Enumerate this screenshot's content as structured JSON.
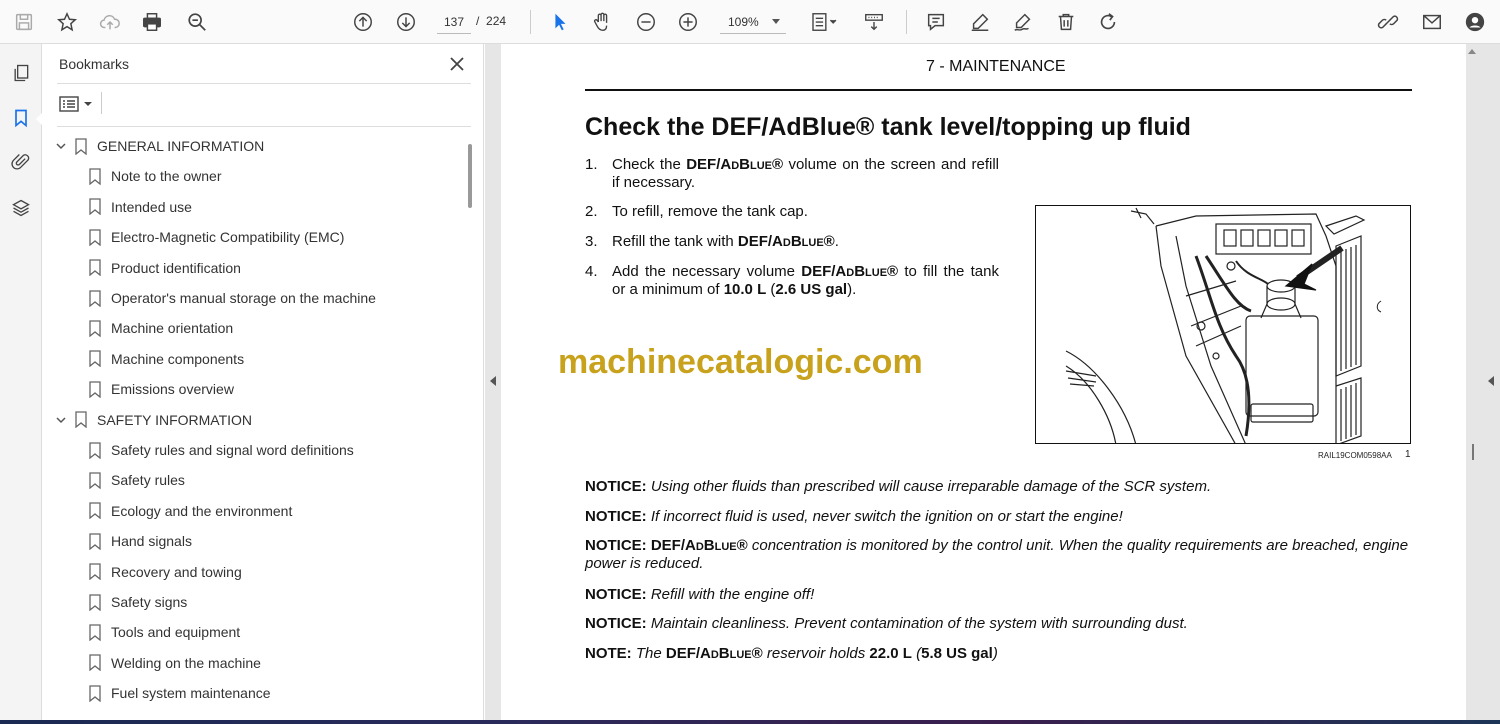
{
  "toolbar": {
    "page_current": "137",
    "page_separator": "/",
    "page_total": "224",
    "zoom": "109%"
  },
  "panel": {
    "title": "Bookmarks"
  },
  "bookmarks": [
    {
      "label": "GENERAL INFORMATION",
      "level": 0
    },
    {
      "label": "Note to the owner",
      "level": 1
    },
    {
      "label": "Intended use",
      "level": 1
    },
    {
      "label": "Electro-Magnetic Compatibility (EMC)",
      "level": 1
    },
    {
      "label": "Product identification",
      "level": 1
    },
    {
      "label": "Operator's manual storage on the machine",
      "level": 1
    },
    {
      "label": "Machine orientation",
      "level": 1
    },
    {
      "label": "Machine components",
      "level": 1
    },
    {
      "label": "Emissions overview",
      "level": 1
    },
    {
      "label": "SAFETY INFORMATION",
      "level": 0
    },
    {
      "label": "Safety rules and signal word definitions",
      "level": 1
    },
    {
      "label": "Safety rules",
      "level": 1
    },
    {
      "label": "Ecology and the environment",
      "level": 1
    },
    {
      "label": "Hand signals",
      "level": 1
    },
    {
      "label": "Recovery and towing",
      "level": 1
    },
    {
      "label": "Safety signs",
      "level": 1
    },
    {
      "label": "Tools and equipment",
      "level": 1
    },
    {
      "label": "Welding on the machine",
      "level": 1
    },
    {
      "label": "Fuel system maintenance",
      "level": 1
    }
  ],
  "document": {
    "chapter": "7 - MAINTENANCE",
    "heading": "Check the DEF/AdBlue® tank level/topping up fluid",
    "steps": [
      {
        "num": "1.",
        "parts": [
          [
            "Check the ",
            ""
          ],
          [
            "DEF/AdBlue®",
            "bsc"
          ],
          [
            " volume on the screen and refill if necessary.",
            ""
          ]
        ]
      },
      {
        "num": "2.",
        "parts": [
          [
            "To refill, remove the tank cap.",
            ""
          ]
        ]
      },
      {
        "num": "3.",
        "parts": [
          [
            "Refill the tank with ",
            ""
          ],
          [
            "DEF/AdBlue®",
            "bsc"
          ],
          [
            ".",
            ""
          ]
        ]
      },
      {
        "num": "4.",
        "parts": [
          [
            "Add the necessary volume ",
            ""
          ],
          [
            "DEF/AdBlue®",
            "bsc"
          ],
          [
            " to fill the tank or a minimum of ",
            ""
          ],
          [
            "10.0 L",
            "b"
          ],
          [
            " (",
            ""
          ],
          [
            "2.6 US gal",
            "b"
          ],
          [
            ").",
            ""
          ]
        ]
      }
    ],
    "watermark": "machinecatalogic.com",
    "figure_ref": "RAIL19COM0598AA",
    "figure_num": "1",
    "notices": [
      {
        "parts": [
          [
            "NOTICE:",
            "b"
          ],
          [
            " Using other fluids than prescribed will cause irreparable damage of the SCR system.",
            ""
          ]
        ]
      },
      {
        "parts": [
          [
            "NOTICE:",
            "b"
          ],
          [
            " If incorrect fluid is used, never switch the ignition on or start the engine!",
            ""
          ]
        ]
      },
      {
        "parts": [
          [
            "NOTICE:",
            "b"
          ],
          [
            " ",
            ""
          ],
          [
            "DEF/AdBlue®",
            "bsc"
          ],
          [
            " concentration is monitored by the control unit.  When the quality requirements are breached, engine power is reduced.",
            ""
          ]
        ]
      },
      {
        "parts": [
          [
            "NOTICE:",
            "b"
          ],
          [
            " Refill with the engine off!",
            ""
          ]
        ]
      },
      {
        "parts": [
          [
            "NOTICE:",
            "b"
          ],
          [
            " Maintain cleanliness.  Prevent contamination of the system with surrounding dust.",
            ""
          ]
        ]
      },
      {
        "parts": [
          [
            "NOTE:",
            "b"
          ],
          [
            " The ",
            ""
          ],
          [
            "DEF/AdBlue®",
            "bsc"
          ],
          [
            " reservoir holds ",
            ""
          ],
          [
            "22.0 L",
            "b"
          ],
          [
            " (",
            ""
          ],
          [
            "5.8 US gal",
            "b"
          ],
          [
            ")",
            ""
          ]
        ]
      }
    ]
  },
  "icons": {
    "toolbar": [
      "save-icon",
      "star-icon",
      "upload-cloud-icon",
      "print-icon",
      "zoom-search-icon",
      "prev-page-icon",
      "next-page-icon",
      "select-cursor-icon",
      "hand-tool-icon",
      "zoom-out-icon",
      "zoom-in-icon",
      "fit-page-icon",
      "scroll-mode-icon",
      "comment-icon",
      "highlight-pen-icon",
      "sign-icon",
      "delete-icon",
      "rotate-icon",
      "share-link-icon",
      "email-icon",
      "account-icon"
    ],
    "rail": [
      "pages-icon",
      "bookmark-icon",
      "attachment-icon",
      "layers-icon"
    ]
  },
  "colors": {
    "watermark": "#c8a21d",
    "active_icon": "#1a73e8"
  }
}
